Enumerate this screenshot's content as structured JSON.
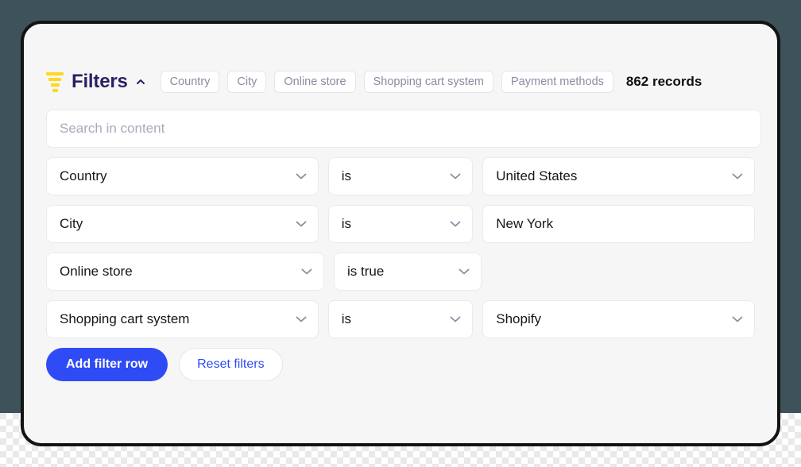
{
  "panel": {
    "title": "Filters",
    "filter_icon": "funnel-icon",
    "collapse_icon": "chevron-up-icon",
    "records_label": "862 records",
    "chips": [
      {
        "label": "Country"
      },
      {
        "label": "City"
      },
      {
        "label": "Online store"
      },
      {
        "label": "Shopping cart system"
      },
      {
        "label": "Payment methods"
      }
    ]
  },
  "search": {
    "value": "",
    "placeholder": "Search in content"
  },
  "filter_rows": [
    {
      "field": "Country",
      "operator": "is",
      "value": "United States",
      "value_type": "select"
    },
    {
      "field": "City",
      "operator": "is",
      "value": "New York",
      "value_type": "text"
    },
    {
      "field": "Online store",
      "operator": "is true",
      "value": "",
      "value_type": "none"
    },
    {
      "field": "Shopping cart system",
      "operator": "is",
      "value": "Shopify",
      "value_type": "select"
    }
  ],
  "actions": {
    "add_label": "Add filter row",
    "reset_label": "Reset filters"
  },
  "colors": {
    "accent_blue": "#2f4bf5",
    "funnel_yellow": "#ffd81f",
    "title_purple": "#2e1f63",
    "chip_text": "#8b8ba4",
    "canvas": "#3d5259",
    "card_bg": "#f6f6f7"
  }
}
